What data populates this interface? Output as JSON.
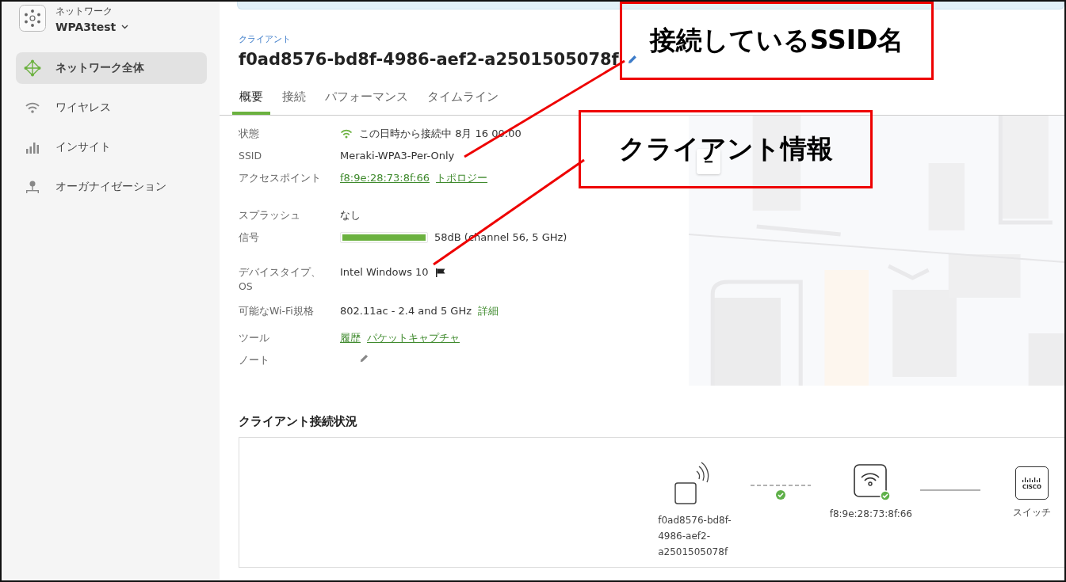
{
  "network": {
    "label": "ネットワーク",
    "name": "WPA3test"
  },
  "sidebar": {
    "items": [
      {
        "label": "ネットワーク全体",
        "selected": true
      },
      {
        "label": "ワイヤレス",
        "selected": false
      },
      {
        "label": "インサイト",
        "selected": false
      },
      {
        "label": "オーガナイゼーション",
        "selected": false
      }
    ]
  },
  "breadcrumb": "クライアント",
  "title": "f0ad8576-bd8f-4986-aef2-a2501505078f",
  "tabs": [
    {
      "label": "概要",
      "selected": true
    },
    {
      "label": "接続",
      "selected": false
    },
    {
      "label": "パフォーマンス",
      "selected": false
    },
    {
      "label": "タイムライン",
      "selected": false
    }
  ],
  "details": [
    {
      "kind": "status",
      "label": "状態",
      "value": "この日時から接続中 8月 16 00:00"
    },
    {
      "kind": "text",
      "label": "SSID",
      "value": "Meraki-WPA3-Per-Only"
    },
    {
      "kind": "links",
      "label": "アクセスポイント",
      "links": [
        "f8:9e:28:73:8f:66",
        "トポロジー"
      ]
    },
    {
      "kind": "text",
      "label": "スプラッシュ",
      "value": "なし"
    },
    {
      "kind": "signal",
      "label": "信号",
      "level": 1.0,
      "value": "58dB  (channel 56, 5 GHz)"
    },
    {
      "kind": "device",
      "label": "デバイスタイプ、OS",
      "value": "Intel Windows 10"
    },
    {
      "kind": "standard",
      "label": "可能なWi-Fi規格",
      "value": "802.11ac - 2.4 and 5 GHz",
      "link": "詳細"
    },
    {
      "kind": "links",
      "label": "ツール",
      "links": [
        "履歴",
        "パケットキャプチャ"
      ]
    },
    {
      "kind": "note",
      "label": "ノート"
    }
  ],
  "connection": {
    "title": "クライアント接続状況",
    "client": "f0ad8576-bd8f-\n4986-aef2-\na2501505078f",
    "access_point": "f8:9e:28:73:8f:66",
    "switch": "スイッチ",
    "switch_logo": "CISCO"
  },
  "annotations": [
    {
      "text": "接続しているSSID名"
    },
    {
      "text": "クライアント情報"
    }
  ]
}
